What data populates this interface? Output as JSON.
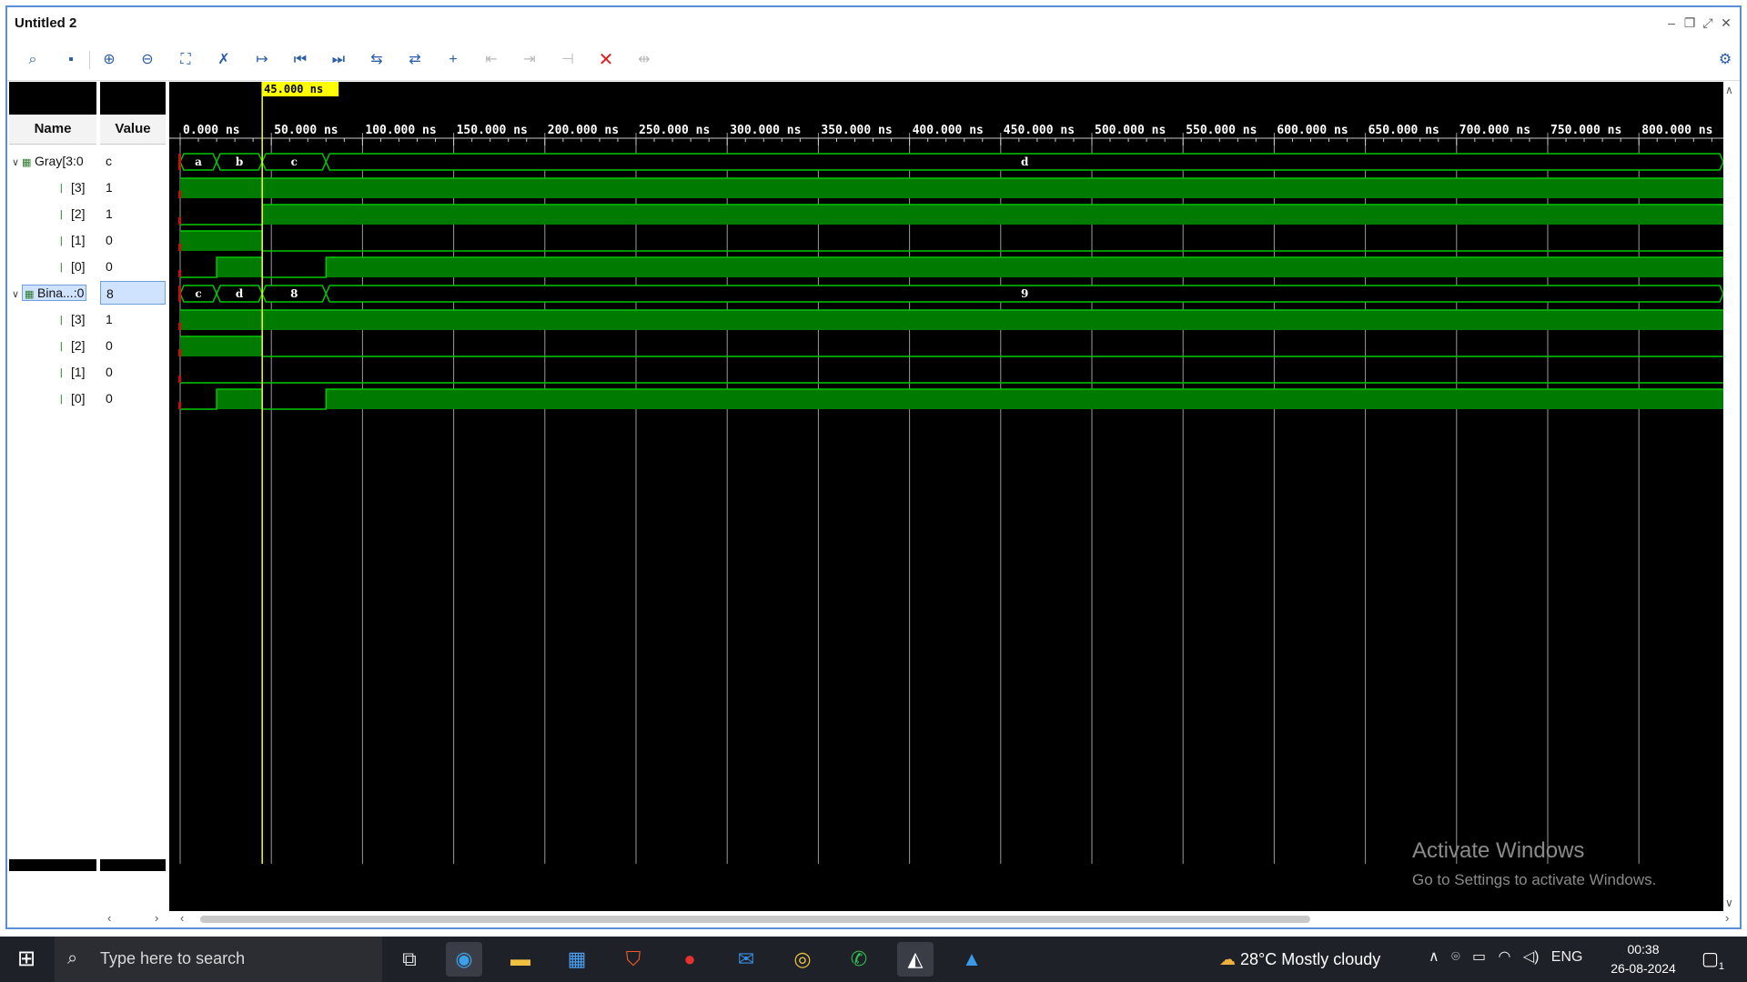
{
  "window": {
    "title": "Untitled 2"
  },
  "toolbar": {
    "icons": [
      "search-icon",
      "save-icon",
      "zoom-in-icon",
      "zoom-out-icon",
      "zoom-fit-icon",
      "snap-icon",
      "go-to-cursor-icon",
      "previous-transition-icon",
      "next-transition-icon",
      "add-marker-icon",
      "previous-marker-icon",
      "next-marker-icon",
      "swap-cursor-icon",
      "remove-marker-icon",
      "remove-all-icon",
      "settings-icon"
    ]
  },
  "panels": {
    "name_header": "Name",
    "value_header": "Value"
  },
  "signals": [
    {
      "name": "Gray[3:0",
      "value": "c",
      "kind": "bus",
      "expanded": true
    },
    {
      "name": "[3]",
      "value": "1",
      "kind": "bit"
    },
    {
      "name": "[2]",
      "value": "1",
      "kind": "bit"
    },
    {
      "name": "[1]",
      "value": "0",
      "kind": "bit"
    },
    {
      "name": "[0]",
      "value": "0",
      "kind": "bit"
    },
    {
      "name": "Bina...:0",
      "value": "8",
      "kind": "bus",
      "expanded": true,
      "selected": true
    },
    {
      "name": "[3]",
      "value": "1",
      "kind": "bit"
    },
    {
      "name": "[2]",
      "value": "0",
      "kind": "bit"
    },
    {
      "name": "[1]",
      "value": "0",
      "kind": "bit"
    },
    {
      "name": "[0]",
      "value": "0",
      "kind": "bit"
    }
  ],
  "waveform": {
    "cursor_label": "45.000 ns",
    "cursor_time": 45,
    "time_end": 850,
    "ticks": [
      "0.000 ns",
      "50.000 ns",
      "100.000 ns",
      "150.000 ns",
      "200.000 ns",
      "250.000 ns",
      "300.000 ns",
      "350.000 ns",
      "400.000 ns",
      "450.000 ns",
      "500.000 ns",
      "550.000 ns",
      "600.000 ns",
      "650.000 ns",
      "700.000 ns",
      "750.000 ns",
      "800.000 ns"
    ],
    "tick_values": [
      0,
      50,
      100,
      150,
      200,
      250,
      300,
      350,
      400,
      450,
      500,
      550,
      600,
      650,
      700,
      750,
      800
    ],
    "gray_bus": [
      {
        "t0": 0,
        "t1": 20,
        "v": "a"
      },
      {
        "t0": 20,
        "t1": 45,
        "v": "b"
      },
      {
        "t0": 45,
        "t1": 80,
        "v": "c"
      },
      {
        "t0": 80,
        "t1": 850,
        "v": "d"
      }
    ],
    "binary_bus": [
      {
        "t0": 0,
        "t1": 20,
        "v": "c"
      },
      {
        "t0": 20,
        "t1": 45,
        "v": "d"
      },
      {
        "t0": 45,
        "t1": 80,
        "v": "8"
      },
      {
        "t0": 80,
        "t1": 850,
        "v": "9"
      }
    ],
    "gray_bits": [
      [
        {
          "t0": 0,
          "t1": 850,
          "v": 1
        }
      ],
      [
        {
          "t0": 0,
          "t1": 45,
          "v": 0
        },
        {
          "t0": 45,
          "t1": 850,
          "v": 1
        }
      ],
      [
        {
          "t0": 0,
          "t1": 45,
          "v": 1
        },
        {
          "t0": 45,
          "t1": 850,
          "v": 0
        }
      ],
      [
        {
          "t0": 0,
          "t1": 20,
          "v": 0
        },
        {
          "t0": 20,
          "t1": 45,
          "v": 1
        },
        {
          "t0": 45,
          "t1": 80,
          "v": 0
        },
        {
          "t0": 80,
          "t1": 850,
          "v": 1
        }
      ]
    ],
    "binary_bits": [
      [
        {
          "t0": 0,
          "t1": 850,
          "v": 1
        }
      ],
      [
        {
          "t0": 0,
          "t1": 45,
          "v": 1
        },
        {
          "t0": 45,
          "t1": 850,
          "v": 0
        }
      ],
      [
        {
          "t0": 0,
          "t1": 850,
          "v": 0
        }
      ],
      [
        {
          "t0": 0,
          "t1": 20,
          "v": 0
        },
        {
          "t0": 20,
          "t1": 45,
          "v": 1
        },
        {
          "t0": 45,
          "t1": 80,
          "v": 0
        },
        {
          "t0": 80,
          "t1": 850,
          "v": 1
        }
      ]
    ]
  },
  "watermark": {
    "line1": "Activate Windows",
    "line2": "Go to Settings to activate Windows."
  },
  "taskbar": {
    "search_placeholder": "Type here to search",
    "weather": "28°C  Mostly cloudy",
    "language": "ENG",
    "time": "00:38",
    "date": "26-08-2024",
    "notification_count": "1"
  }
}
